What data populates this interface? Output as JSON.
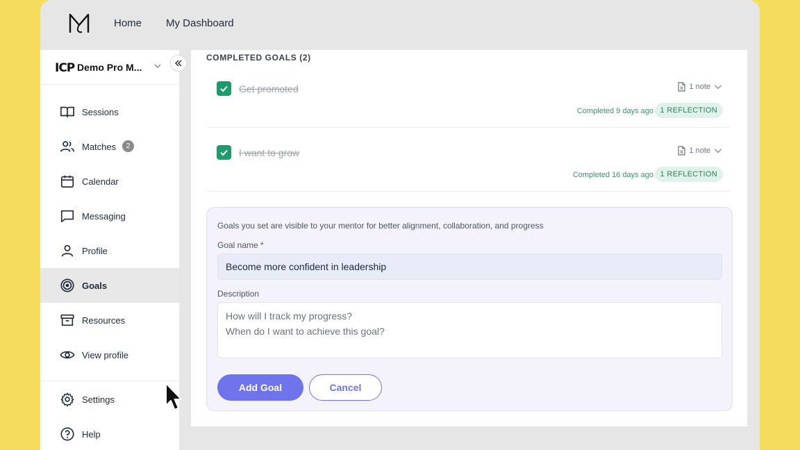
{
  "topbar": {
    "logo_icon": "m-logo-icon",
    "nav": [
      {
        "label": "Home"
      },
      {
        "label": "My Dashboard"
      }
    ]
  },
  "sidebar": {
    "org": {
      "logo_text": "ICP",
      "name": "Demo Pro M...",
      "chevron_icon": "chevron-down-icon"
    },
    "collapse_icon": "double-chevron-left-icon",
    "items": [
      {
        "label": "Sessions",
        "icon": "book-open-icon"
      },
      {
        "label": "Matches",
        "icon": "users-icon",
        "badge": "2"
      },
      {
        "label": "Calendar",
        "icon": "calendar-icon"
      },
      {
        "label": "Messaging",
        "icon": "message-icon"
      },
      {
        "label": "Profile",
        "icon": "user-icon"
      },
      {
        "label": "Goals",
        "icon": "target-icon",
        "active": true
      },
      {
        "label": "Resources",
        "icon": "archive-icon"
      },
      {
        "label": "View profile",
        "icon": "eye-icon"
      },
      {
        "label": "Settings",
        "icon": "gear-icon"
      },
      {
        "label": "Help",
        "icon": "help-circle-icon"
      }
    ]
  },
  "main": {
    "completed_title": "COMPLETED GOALS (2)",
    "goals": [
      {
        "title": "Get promoted",
        "notes": "1 note",
        "completed": "Completed 9 days ago",
        "reflection": "1 REFLECTION"
      },
      {
        "title": "I want to grow",
        "notes": "1 note",
        "completed": "Completed 16 days ago",
        "reflection": "1 REFLECTION"
      }
    ],
    "form": {
      "hint": "Goals you set are visible to your mentor for better alignment, collaboration, and progress",
      "goal_name_label": "Goal name *",
      "goal_name_value": "Become more confident in leadership",
      "description_label": "Description",
      "description_placeholder": "How will I track my progress?\nWhen do I want to achieve this goal?",
      "add_label": "Add Goal",
      "cancel_label": "Cancel"
    }
  },
  "colors": {
    "background": "#f5dc5c",
    "accent": "#6f74ec",
    "success": "#1e9a6b",
    "reflection_bg": "#dff3ea"
  }
}
